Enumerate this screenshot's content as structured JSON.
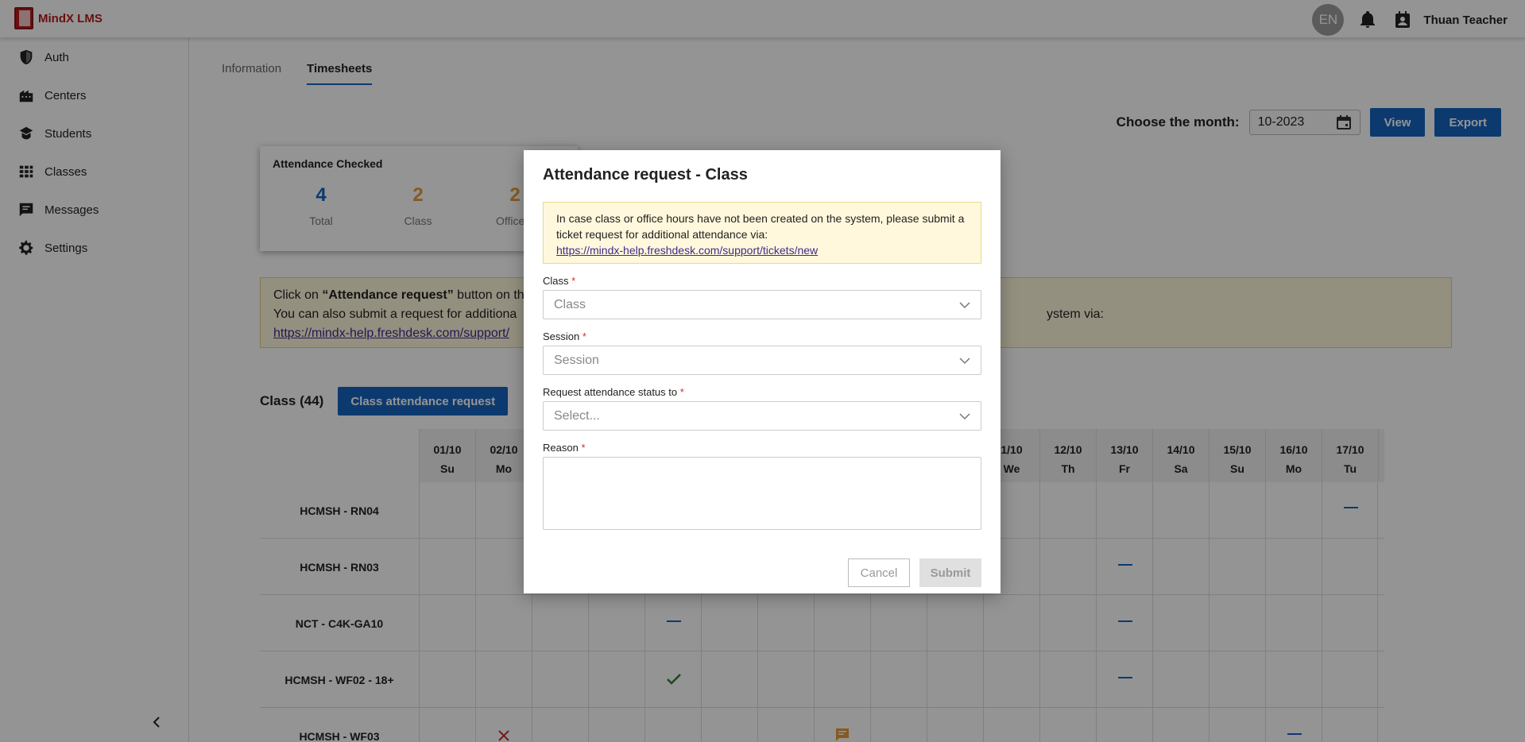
{
  "app": {
    "name": "MindX LMS"
  },
  "topbar": {
    "lang": "EN",
    "user": "Thuan Teacher",
    "icons": [
      "bell-icon",
      "contact-icon"
    ]
  },
  "sidebar": {
    "items": [
      {
        "label": "Auth",
        "icon": "shield-icon"
      },
      {
        "label": "Centers",
        "icon": "building-icon"
      },
      {
        "label": "Students",
        "icon": "student-icon"
      },
      {
        "label": "Classes",
        "icon": "grid-icon"
      },
      {
        "label": "Messages",
        "icon": "message-icon"
      },
      {
        "label": "Settings",
        "icon": "gear-icon"
      }
    ]
  },
  "tabs": [
    {
      "label": "Information",
      "active": false
    },
    {
      "label": "Timesheets",
      "active": true
    }
  ],
  "month": {
    "label": "Choose the month:",
    "value": "10-2023",
    "view": "View",
    "export": "Export"
  },
  "stats": {
    "title": "Attendance Checked",
    "items": [
      {
        "value": "4",
        "label": "Total",
        "color": "#1565c0"
      },
      {
        "value": "2",
        "label": "Class",
        "color": "#e69a3c"
      },
      {
        "value": "2",
        "label": "Office h",
        "color": "#e69a3c"
      }
    ]
  },
  "notice": {
    "line1_pre": "Click on ",
    "line1_bold": "“Attendance request”",
    "line1_post": " button on the",
    "line2a": "You can also submit a request for additiona",
    "line2b": "ystem via:",
    "link": "https://mindx-help.freshdesk.com/support/"
  },
  "class_section": {
    "title": "Class (44)",
    "button": "Class attendance request"
  },
  "timesheet": {
    "visible_days": [
      {
        "date": "01/10",
        "dow": "Su"
      },
      {
        "date": "02/10",
        "dow": "Mo"
      },
      {
        "date": "1/10",
        "dow": "We"
      },
      {
        "date": "12/10",
        "dow": "Th"
      },
      {
        "date": "13/10",
        "dow": "Fr"
      },
      {
        "date": "14/10",
        "dow": "Sa"
      },
      {
        "date": "15/10",
        "dow": "Su"
      },
      {
        "date": "16/10",
        "dow": "Mo"
      },
      {
        "date": "17/10",
        "dow": "Tu"
      }
    ],
    "rows": [
      {
        "name": "HCMSH - RN04"
      },
      {
        "name": "HCMSH - RN03"
      },
      {
        "name": "NCT - C4K-GA10"
      },
      {
        "name": "HCMSH - WF02 - 18+"
      },
      {
        "name": "HCMSH - WF03"
      }
    ]
  },
  "modal": {
    "title": "Attendance request - Class",
    "notice_text": "In case class or office hours have not been created on the system, please submit a ticket request for additional attendance via:",
    "notice_link": "https://mindx-help.freshdesk.com/support/tickets/new",
    "fields": {
      "class": {
        "label": "Class",
        "placeholder": "Class"
      },
      "session": {
        "label": "Session",
        "placeholder": "Session"
      },
      "status": {
        "label": "Request attendance status to",
        "placeholder": "Select..."
      },
      "reason": {
        "label": "Reason"
      }
    },
    "required_mark": "*",
    "cancel": "Cancel",
    "submit": "Submit"
  },
  "colors": {
    "primary": "#1565c0",
    "accent": "#e69a3c",
    "brand": "#b71c1c",
    "ok": "#2e7d32",
    "error": "#c62828"
  }
}
